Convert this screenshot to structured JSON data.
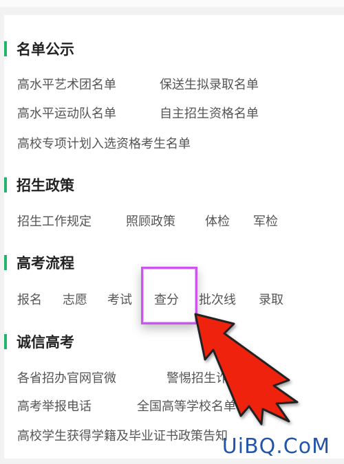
{
  "sections": [
    {
      "title": "名单公示",
      "rows": [
        [
          "高水平艺术团名单",
          "保送生拟录取名单"
        ],
        [
          "高水平运动队名单",
          "自主招生资格名单"
        ],
        [
          "高校专项计划入选资格考生名单"
        ]
      ]
    },
    {
      "title": "招生政策",
      "rows": [
        [
          "招生工作规定",
          "照顾政策",
          "体检",
          "军检"
        ]
      ]
    },
    {
      "title": "高考流程",
      "rows": [
        [
          "报名",
          "志愿",
          "考试",
          "查分",
          "批次线",
          "录取"
        ]
      ]
    },
    {
      "title": "诚信高考",
      "rows": [
        [
          "各省招办官网官微",
          "警惕招生诈骗"
        ],
        [
          "高考举报电话",
          "全国高等学校名单"
        ],
        [
          "高校学生获得学籍及毕业证书政策告知"
        ]
      ]
    }
  ],
  "colors": {
    "accent_bar": "#23b36b",
    "highlight_box": "#cc55ee",
    "arrow": "#ee2211"
  },
  "watermark": "UiBQ.CoM"
}
